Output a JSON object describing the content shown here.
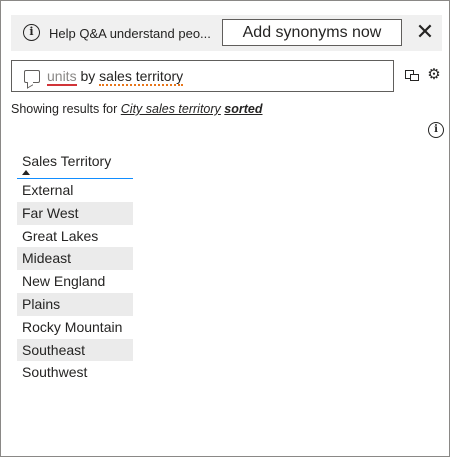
{
  "banner": {
    "info_icon": "info-circle-icon",
    "text": "Help Q&A understand peo...",
    "button_label": "Add synonyms now",
    "close_glyph": "✕"
  },
  "query": {
    "chat_icon": "chat-bubble-icon",
    "word_units": "units",
    "word_by": " by ",
    "word_sales_territory": "sales territory"
  },
  "toolbar": {
    "share_icon": "share-icon",
    "settings_icon": "gear-icon",
    "settings_glyph": "⚙"
  },
  "results": {
    "prefix": "Showing results for ",
    "link_text": "City sales territory",
    "sorted_text": "sorted"
  },
  "info_icon_right": "info-circle-icon",
  "table": {
    "header": "Sales Territory",
    "sort": "ascending",
    "rows": [
      "External",
      "Far West",
      "Great Lakes",
      "Mideast",
      "New England",
      "Plains",
      "Rocky Mountain",
      "Southeast",
      "Southwest"
    ]
  },
  "colors": {
    "accent": "#118dff",
    "error_underline": "#d13438",
    "warning_underline": "#e8761a",
    "banner_bg": "#f0f0f0",
    "alt_row": "#ebebeb"
  }
}
